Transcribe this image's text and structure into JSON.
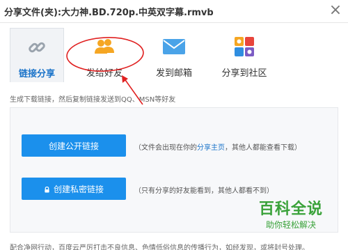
{
  "window": {
    "title": "分享文件(夹):大力神.BD.720p.中英双字幕.rmvb",
    "close_glyph": "×"
  },
  "tabs": [
    {
      "label": "链接分享",
      "icon": "link-icon",
      "active": true
    },
    {
      "label": "发给好友",
      "icon": "friends-icon",
      "active": false
    },
    {
      "label": "发到邮箱",
      "icon": "envelope-icon",
      "active": false
    },
    {
      "label": "分享到社区",
      "icon": "community-icon",
      "active": false
    }
  ],
  "hint": "生成下载链接，然后复制链接发送到QQ、MSN等好友",
  "public_link": {
    "button_label": "创建公开链接",
    "desc_before": "（文件会出现在你的",
    "desc_link": "分享主页",
    "desc_after": "，其他人都能查看下载）"
  },
  "private_link": {
    "button_label": "创建私密链接",
    "desc": "（只有分享的好友能看到，其他人都看不到）"
  },
  "footer": "配合净网行动，百度云严厉打击不良信息、色情低俗信息的传播行为，如经发现，或将封号处理。",
  "watermark": {
    "big": "百科全说",
    "small": "助你轻松解决"
  },
  "colors": {
    "accent_blue": "#1b90ec",
    "link_blue": "#1a73c9",
    "annotation_red": "#e02020",
    "watermark_green": "#3aa23a"
  }
}
